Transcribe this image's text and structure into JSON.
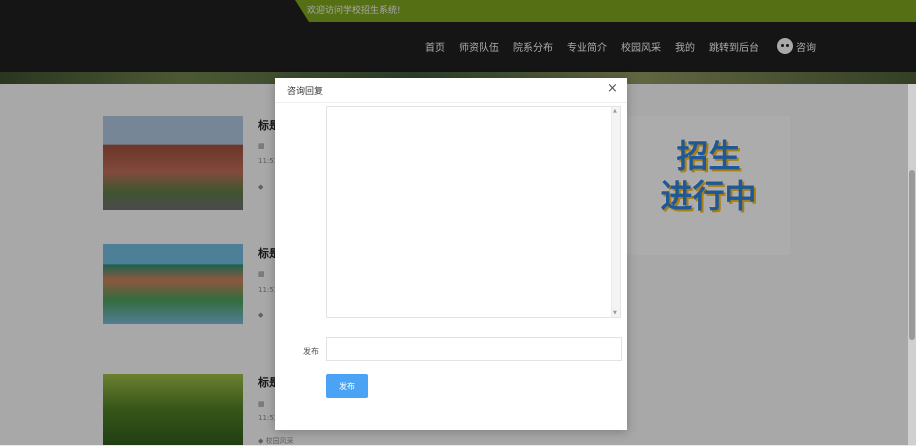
{
  "header": {
    "welcome": "欢迎访问学校招生系统!",
    "nav": [
      "首页",
      "师资队伍",
      "院系分布",
      "专业简介",
      "校园风采",
      "我的",
      "跳转到后台"
    ],
    "consult": "咨询"
  },
  "list": {
    "title_fragment": "标是",
    "time_fragment": "11:53",
    "last_tag": "校园风采"
  },
  "promo": {
    "line1": "招生",
    "line2": "进行中"
  },
  "dialog": {
    "title": "咨询回复",
    "close": "×",
    "publish_label": "发布",
    "submit_label": "发布",
    "input_value": ""
  },
  "icons": {
    "calendar": "calendar-icon",
    "tag": "tag-icon",
    "close": "close-icon",
    "wechat": "wechat-icon"
  },
  "colors": {
    "green_bar": "#7aa01d",
    "submit_blue": "#4aa3f5",
    "topbar": "#1f1f1f"
  }
}
